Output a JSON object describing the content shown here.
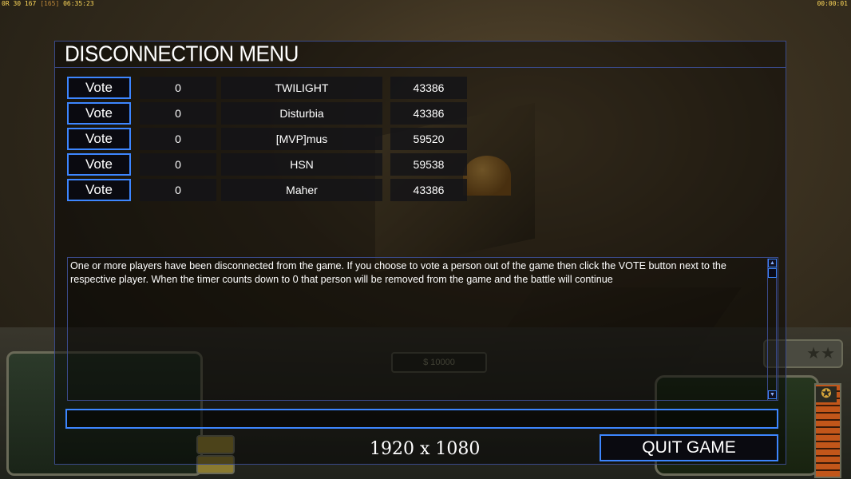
{
  "overlay": {
    "stats_left_a": "0R 30 167",
    "stats_left_b": "[165]",
    "stats_left_c": "06:35:23",
    "stats_right": "00:00:01"
  },
  "hud": {
    "money": "$ 10000",
    "rank_stars": "★★"
  },
  "dialog": {
    "title": "DISCONNECTION MENU",
    "vote_label": "Vote",
    "players": [
      {
        "votes": "0",
        "name": "TWILIGHT",
        "ping": "43386"
      },
      {
        "votes": "0",
        "name": "Disturbia",
        "ping": "43386"
      },
      {
        "votes": "0",
        "name": "[MVP]mus",
        "ping": "59520"
      },
      {
        "votes": "0",
        "name": "HSN",
        "ping": "59538"
      },
      {
        "votes": "0",
        "name": "Maher",
        "ping": "43386"
      }
    ],
    "message": "One or more players have been disconnected from the game. If you choose to vote a person out of the game then click the VOTE button next to the respective player. When the timer counts down to 0 that person will be removed from the game and the battle will continue",
    "chat_value": "",
    "quit_label": "QUIT GAME",
    "resolution": "1920 x 1080"
  }
}
